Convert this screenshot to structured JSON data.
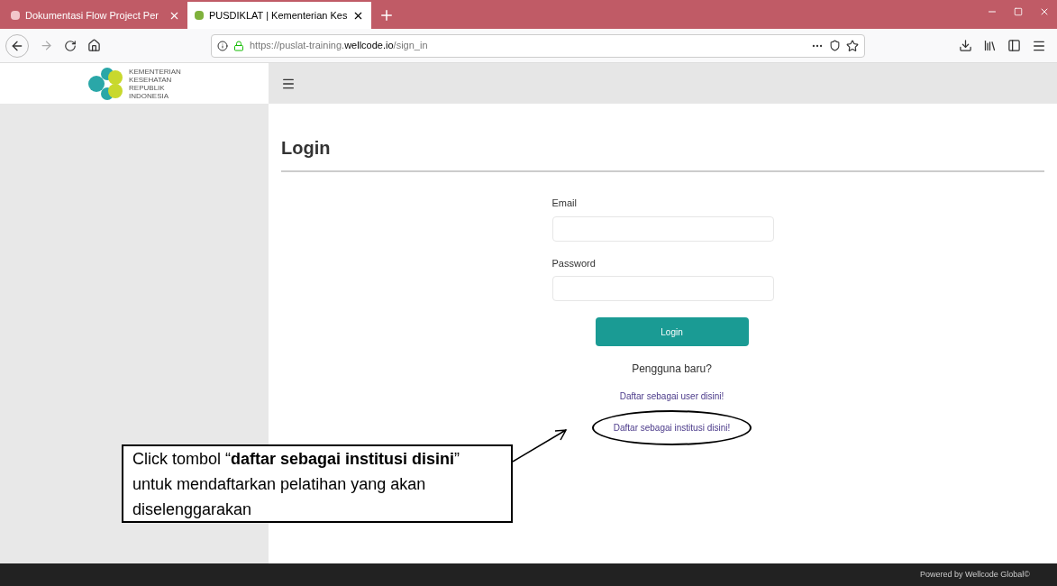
{
  "browser": {
    "tabs": [
      {
        "title": "Dokumentasi Flow Project Per",
        "selected": false
      },
      {
        "title": "PUSDIKLAT | Kementerian Kes",
        "selected": true
      }
    ],
    "url": {
      "scheme": "https://puslat-training.",
      "domain": "wellcode.io",
      "path": "/sign_in"
    }
  },
  "logo": {
    "lines": [
      "KEMENTERIAN",
      "KESEHATAN",
      "REPUBLIK",
      "INDONESIA"
    ]
  },
  "page": {
    "title": "Login",
    "fields": [
      {
        "label": "Email"
      },
      {
        "label": "Password"
      }
    ],
    "login_button": "Login",
    "new_user": "Pengguna baru?",
    "links": [
      {
        "text": "Daftar sebagai user disini!",
        "circled": false
      },
      {
        "text": "Daftar sebagai institusi disini!",
        "circled": true
      }
    ]
  },
  "callout": {
    "text": "Click tombol “**daftar sebagai institusi disini**” untuk mendaftarkan pelatihan yang akan diselenggarakan"
  },
  "footer": "Powered by Wellcode Global©"
}
